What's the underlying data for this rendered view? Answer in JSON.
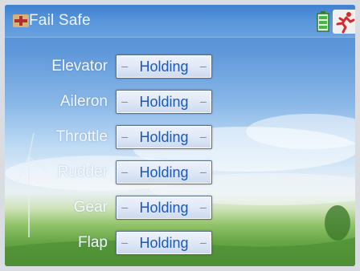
{
  "window": {
    "title": "Fail Safe"
  },
  "rows": [
    {
      "channel": "Elevator",
      "value": "Holding"
    },
    {
      "channel": "Aileron",
      "value": "Holding"
    },
    {
      "channel": "Throttle",
      "value": "Holding"
    },
    {
      "channel": "Rudder",
      "value": "Holding"
    },
    {
      "channel": "Gear",
      "value": "Holding"
    },
    {
      "channel": "Flap",
      "value": "Holding"
    }
  ],
  "icons": {
    "title": "plane-icon",
    "battery": "battery-icon",
    "exit": "running-man-icon"
  },
  "colors": {
    "title_bar": "#4a8ad4",
    "button_text": "#1f58b8",
    "label_text": "#f4f8ff"
  }
}
